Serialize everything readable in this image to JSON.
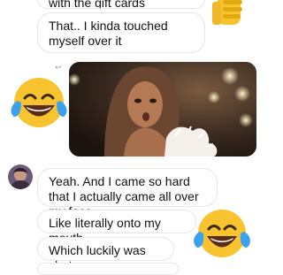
{
  "messages": [
    {
      "text": "with the gift cards"
    },
    {
      "text": "That.. I kinda touched myself over it"
    },
    {
      "text": "Yeah. And I came so hard that I actually came all over my face"
    },
    {
      "text": "Like literally onto my mouth"
    },
    {
      "text": "Which luckily was shut"
    }
  ],
  "emojis": {
    "top_right": "thumbs-up-icon",
    "left": "laughing-crying-icon",
    "right": "laughing-crying-icon"
  },
  "colors": {
    "bubble_border": "#e6e6e6",
    "emoji_yellow": "#f7c32e",
    "tear_blue": "#3aa0f0"
  }
}
